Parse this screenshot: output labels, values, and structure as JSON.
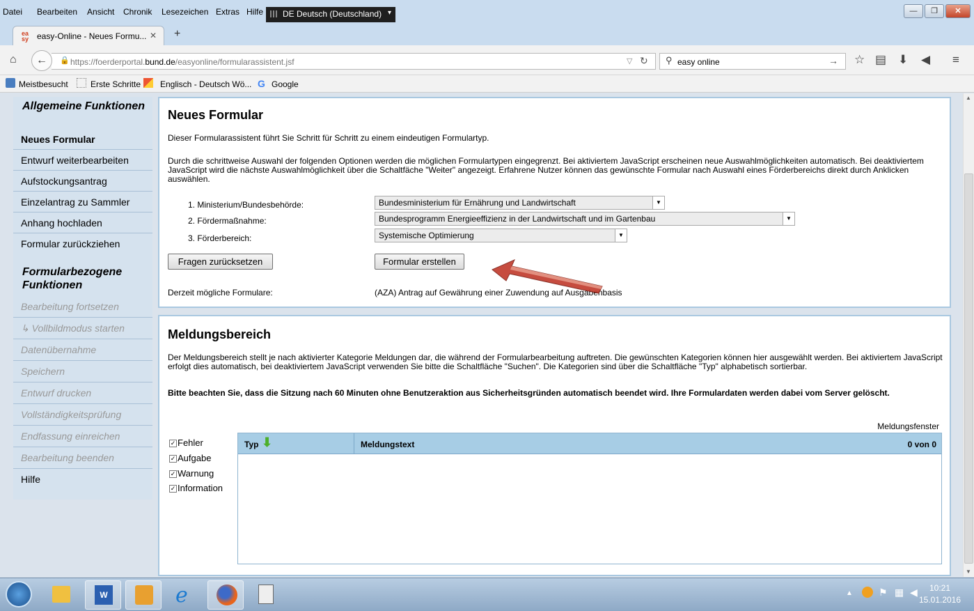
{
  "menu": {
    "items": [
      "Datei",
      "Bearbeiten",
      "Ansicht",
      "Chronik",
      "Lesezeichen",
      "Extras",
      "Hilfe"
    ],
    "language": "DE Deutsch (Deutschland)"
  },
  "tab": {
    "title": "easy-Online - Neues Formu...",
    "favicon": "ea sy"
  },
  "nav": {
    "url_prefix": "https://foerderportal.",
    "url_domain": "bund.de",
    "url_path": "/easyonline/formularassistent.jsf",
    "search_value": "easy online"
  },
  "bookmarks": [
    "Meistbesucht",
    "Erste Schritte",
    "Englisch - Deutsch Wö...",
    "Google"
  ],
  "sidebar": {
    "heading1": "Allgemeine Funktionen",
    "items1": [
      "Neues Formular",
      "Entwurf weiterbearbeiten",
      "Aufstockungsantrag",
      "Einzelantrag zu Sammler",
      "Anhang hochladen",
      "Formular zurückziehen"
    ],
    "heading2": "Formularbezogene Funktionen",
    "items2": [
      "Bearbeitung fortsetzen",
      "↳ Vollbildmodus starten",
      "Datenübernahme",
      "Speichern",
      "Entwurf drucken",
      "Vollständigkeitsprüfung",
      "Endfassung einreichen",
      "Bearbeitung beenden"
    ],
    "help": "Hilfe"
  },
  "form": {
    "title": "Neues Formular",
    "intro": "Dieser Formularassistent führt Sie Schritt für Schritt zu einem eindeutigen Formulartyp.",
    "desc": "Durch die schrittweise Auswahl der folgenden Optionen werden die möglichen Formulartypen eingegrenzt. Bei aktiviertem JavaScript erscheinen neue Auswahlmöglichkeiten automatisch. Bei deaktiviertem JavaScript wird die nächste Auswahlmöglichkeit über die Schaltfäche \"Weiter\" angezeigt. Erfahrene Nutzer können das gewünschte Formular nach Auswahl eines Förderbereichs direkt durch Anklicken auswählen.",
    "label1": "1. Ministerium/Bundesbehörde:",
    "value1": "Bundesministerium für Ernährung und Landwirtschaft",
    "label2": "2. Fördermaßnahme:",
    "value2": "Bundesprogramm Energieeffizienz in der Landwirtschaft und im Gartenbau",
    "label3": "3. Förderbereich:",
    "value3": "Systemische Optimierung",
    "reset_label": "Fragen zurücksetzen",
    "create_label": "Formular erstellen",
    "possible_label": "Derzeit mögliche Formulare:",
    "possible_value": "(AZA) Antrag auf Gewährung einer Zuwendung auf Ausgabenbasis"
  },
  "messages": {
    "title": "Meldungsbereich",
    "desc": "Der Meldungsbereich stellt je nach aktivierter Kategorie Meldungen dar, die während der Formularbearbeitung auftreten. Die gewünschten Kategorien können hier ausgewählt werden. Bei aktiviertem JavaScript erfolgt dies automatisch, bei deaktiviertem JavaScript verwenden Sie bitte die Schaltfläche \"Suchen\". Die Kategorien sind über die Schaltfläche \"Typ\" alphabetisch sortierbar.",
    "warning": "Bitte beachten Sie, dass die Sitzung nach 60 Minuten ohne Benutzeraktion aus Sicherheitsgründen automatisch beendet wird. Ihre Formulardaten werden dabei vom Server gelöscht.",
    "window_label": "Meldungsfenster",
    "categories": [
      "Fehler",
      "Aufgabe",
      "Warnung",
      "Information"
    ],
    "col_type": "Typ",
    "col_text": "Meldungstext",
    "count": "0 von 0"
  },
  "taskbar": {
    "time": "10:21",
    "date": "15.01.2016"
  }
}
